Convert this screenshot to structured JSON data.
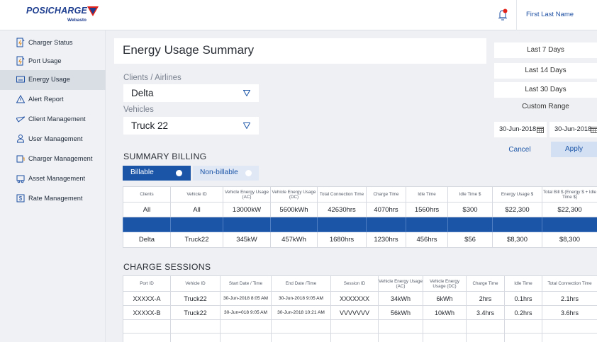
{
  "brand": {
    "name": "POSICHARGE",
    "sub": "Webasto"
  },
  "header": {
    "user_name": "First Last Name"
  },
  "sidebar": {
    "items": [
      {
        "label": "Charger Status",
        "icon": "charger-status-icon"
      },
      {
        "label": "Port Usage",
        "icon": "port-usage-icon"
      },
      {
        "label": "Energy Usage",
        "icon": "energy-usage-icon",
        "active": true
      },
      {
        "label": "Alert Report",
        "icon": "alert-icon"
      },
      {
        "label": "Client Management",
        "icon": "client-icon"
      },
      {
        "label": "User Management",
        "icon": "user-icon"
      },
      {
        "label": "Charger Management",
        "icon": "charger-management-icon"
      },
      {
        "label": "Asset Management",
        "icon": "asset-icon"
      },
      {
        "label": "Rate Management",
        "icon": "rate-icon"
      }
    ]
  },
  "main": {
    "title": "Energy Usage Summary",
    "clients_label": "Clients / Airlines",
    "clients_value": "Delta",
    "vehicles_label": "Vehicles",
    "vehicles_value": "Truck 22"
  },
  "billing": {
    "title": "SUMMARY BILLING",
    "toggle_billable": "Billable",
    "toggle_non_billable": "Non-billable",
    "columns": [
      "Clients",
      "Vehicle ID",
      "Vehicle Energy Usage (AC)",
      "Vehicle Energy Usage (DC)",
      "Total Connection Time",
      "Charge Time",
      "Idle Time",
      "Idle Time $",
      "Energy Usage $",
      "Total Bill $ (Energy $ + Idle Time $)"
    ],
    "rows": [
      [
        "All",
        "All",
        "13000kW",
        "5600kWh",
        "42630hrs",
        "4070hrs",
        "1560hrs",
        "$300",
        "$22,300",
        "$22,300"
      ],
      [
        "",
        "",
        "",
        "",
        "",
        "",
        "",
        "",
        "",
        ""
      ],
      [
        "Delta",
        "Truck22",
        "345kW",
        "457kWh",
        "1680hrs",
        "1230hrs",
        "456hrs",
        "$56",
        "$8,300",
        "$8,300"
      ]
    ]
  },
  "sessions": {
    "title": "CHARGE SESSIONS",
    "columns": [
      "Port ID",
      "Vehicle ID",
      "Start Date / Time",
      "End Date /Time",
      "Session ID",
      "Vehicle Energy Usage (AC)",
      "Vehicle Energy Usage (DC)",
      "Charge Time",
      "Idle Time",
      "Total Connection Time"
    ],
    "rows": [
      [
        "XXXXX-A",
        "Truck22",
        "30-Jun-2018 8:05 AM",
        "30-Jun-2018 9:05 AM",
        "XXXXXXX",
        "34kWh",
        "6kWh",
        "2hrs",
        "0.1hrs",
        "2.1hrs"
      ],
      [
        "XXXXX-B",
        "Truck22",
        "30-Jun=018 9:05 AM",
        "30-Jun-2018 10:21 AM",
        "VVVVVVV",
        "56kWh",
        "10kWh",
        "3.4hrs",
        "0.2hrs",
        "3.6hrs"
      ],
      [
        "",
        "",
        "",
        "",
        "",
        "",
        "",
        "",
        "",
        ""
      ],
      [
        "",
        "",
        "",
        "",
        "",
        "",
        "",
        "",
        "",
        ""
      ]
    ]
  },
  "date_range": {
    "options": [
      "Last 7 Days",
      "Last 14 Days",
      "Last 30 Days"
    ],
    "custom_label": "Custom Range",
    "start_date": "30-Jun-2018",
    "end_date": "30-Jun-2018",
    "cancel_label": "Cancel",
    "apply_label": "Apply"
  }
}
